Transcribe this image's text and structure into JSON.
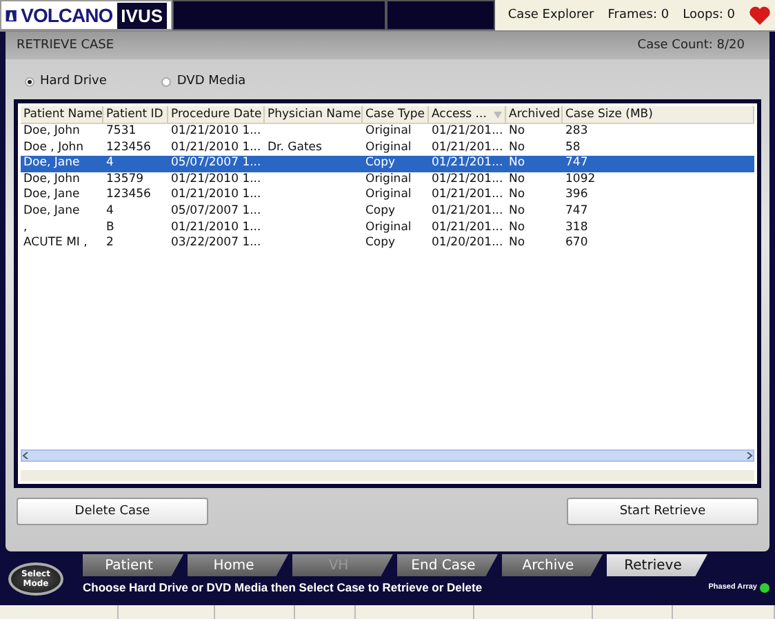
{
  "header": {
    "brand": "VOLCANO",
    "product": "IVUS",
    "mode": "Case Explorer",
    "frames": "Frames: 0",
    "loops": "Loops: 0"
  },
  "panel": {
    "title": "RETRIEVE CASE",
    "count": "Case Count: 8/20"
  },
  "sources": [
    {
      "label": "Hard Drive",
      "selected": true
    },
    {
      "label": "DVD Media",
      "selected": false
    }
  ],
  "table": {
    "columns": [
      "Patient Name",
      "Patient ID",
      "Procedure Date",
      "Physician Name",
      "Case Type",
      "Access ...",
      "Archived",
      "Case Size (MB)"
    ],
    "rows": [
      {
        "cells": [
          "Doe, John",
          "7531",
          "01/21/2010 1...",
          "",
          "Original",
          "01/21/201...",
          "No",
          "283"
        ],
        "selected": false
      },
      {
        "cells": [
          "Doe , John",
          "123456",
          "01/21/2010 1...",
          "Dr. Gates",
          "Original",
          "01/21/201...",
          "No",
          "58"
        ],
        "selected": false
      },
      {
        "cells": [
          "Doe, Jane",
          "4",
          "05/07/2007 1...",
          "",
          "Copy",
          "01/21/201...",
          "No",
          "747"
        ],
        "selected": true
      },
      {
        "cells": [
          "Doe, John",
          "13579",
          "01/21/2010 1...",
          "",
          "Original",
          "01/21/201...",
          "No",
          "1092"
        ],
        "selected": false
      },
      {
        "cells": [
          "Doe, Jane",
          "123456",
          "01/21/2010 1...",
          "",
          "Original",
          "01/21/201...",
          "No",
          "396"
        ],
        "selected": false
      },
      {
        "cells": [
          "Doe, Jane",
          "4",
          "05/07/2007 1...",
          "",
          "Copy",
          "01/21/201...",
          "No",
          "747"
        ],
        "selected": false
      },
      {
        "cells": [
          ",",
          "B",
          "01/21/2010 1...",
          "",
          "Original",
          "01/21/201...",
          "No",
          "318"
        ],
        "selected": false
      },
      {
        "cells": [
          "ACUTE MI ,",
          "2",
          "03/22/2007 1...",
          "",
          "Copy",
          "01/20/201...",
          "No",
          "670"
        ],
        "selected": false
      }
    ]
  },
  "actions": [
    "Delete Case",
    "Start Retrieve"
  ],
  "mode_button": "Select Mode",
  "nav_tabs": [
    {
      "label": "Patient",
      "selected": false,
      "disabled": false
    },
    {
      "label": "Home",
      "selected": false,
      "disabled": false
    },
    {
      "label": "VH",
      "selected": false,
      "disabled": true
    },
    {
      "label": "End Case",
      "selected": false,
      "disabled": false
    },
    {
      "label": "Archive",
      "selected": false,
      "disabled": false
    },
    {
      "label": "Retrieve",
      "selected": true,
      "disabled": false
    }
  ],
  "message": "Choose Hard Drive or DVD Media then Select Case to Retrieve or Delete",
  "array": {
    "label": "Phased Array",
    "on": true
  }
}
